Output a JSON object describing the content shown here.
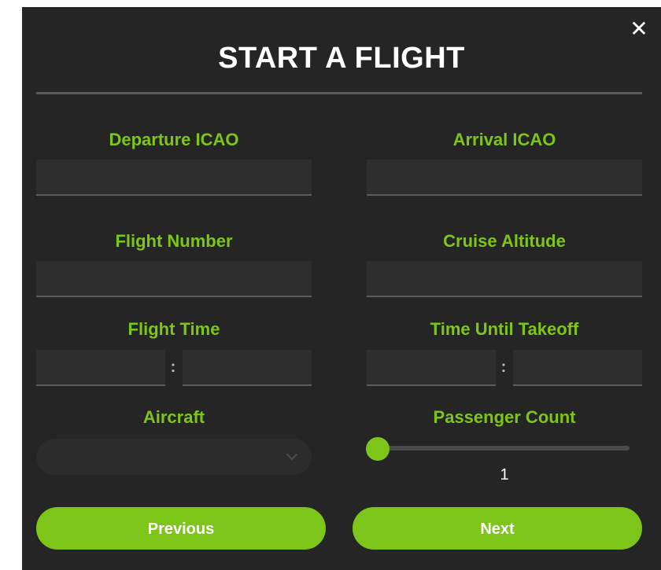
{
  "dialog": {
    "title": "START A FLIGHT",
    "close_label": "✕"
  },
  "fields": {
    "departure": {
      "label": "Departure ICAO",
      "value": "",
      "placeholder": ""
    },
    "arrival": {
      "label": "Arrival ICAO",
      "value": "",
      "placeholder": ""
    },
    "flight_number": {
      "label": "Flight Number",
      "value": "",
      "placeholder": ""
    },
    "cruise_altitude": {
      "label": "Cruise Altitude",
      "value": "",
      "placeholder": ""
    },
    "flight_time": {
      "label": "Flight Time",
      "separator": ":",
      "hours": "",
      "minutes": ""
    },
    "time_until_takeoff": {
      "label": "Time Until Takeoff",
      "separator": ":",
      "hours": "",
      "minutes": ""
    },
    "aircraft": {
      "label": "Aircraft",
      "selected": ""
    },
    "passenger_count": {
      "label": "Passenger Count",
      "value": "1",
      "min_fraction": 0
    }
  },
  "buttons": {
    "previous": "Previous",
    "next": "Next"
  },
  "colors": {
    "accent": "#7ec51a",
    "background": "#252525",
    "text": "#ffffff"
  },
  "icons": {
    "close": "close-icon",
    "aircraft_dropdown": "chevron-down-icon"
  }
}
